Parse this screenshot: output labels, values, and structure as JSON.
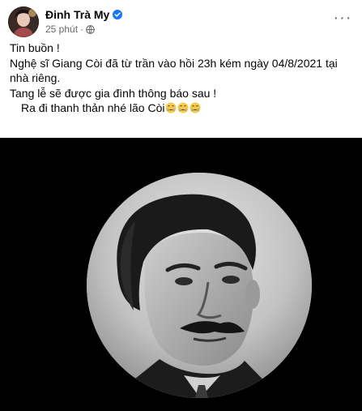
{
  "post": {
    "author": "Đinh Trà My",
    "verified_icon": "verified-badge-icon",
    "timestamp": "25 phút",
    "separator": "·",
    "audience_icon": "globe-icon",
    "more_icon": "more-options-icon",
    "more_label": "···",
    "content": {
      "line1": "Tin buồn !",
      "line2": "Nghệ sĩ Giang Còi đã từ trần vào hồi 23h kém ngày 04/8/2021 tại nhà riêng.",
      "line3": "Tang lễ sẽ được gia đình thông báo sau !",
      "line4": "Ra đi thanh thản nhé lão Còi",
      "emojis": [
        "crying-face-emoji",
        "crying-face-emoji",
        "crying-face-emoji"
      ]
    },
    "image": {
      "description_icon": "black-white-portrait-photo",
      "background_color": "#000000"
    }
  },
  "colors": {
    "text": "#050505",
    "secondary_text": "#65676b",
    "verified_blue": "#1877f2"
  }
}
